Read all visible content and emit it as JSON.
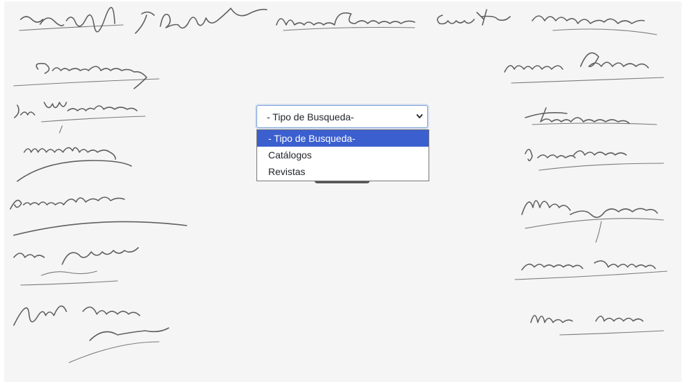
{
  "search_type_select": {
    "selected_value": "- Tipo de Busqueda-",
    "options": [
      {
        "label": "- Tipo de Busqueda-",
        "highlighted": true
      },
      {
        "label": "Catálogos",
        "highlighted": false
      },
      {
        "label": "Revistas",
        "highlighted": false
      }
    ]
  },
  "colors": {
    "highlight": "#3b5fcf",
    "panel_background": "#f5f5f5",
    "ink": "#444444"
  },
  "icons": {
    "select_arrow": "chevron-down-icon"
  }
}
